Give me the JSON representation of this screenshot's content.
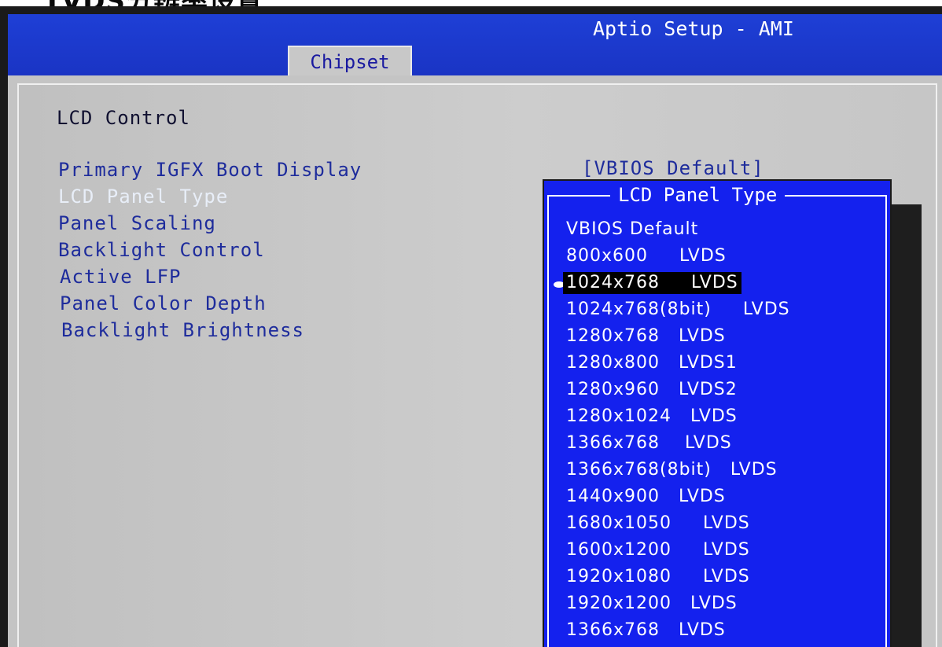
{
  "photo_heading": "LVDS分辨率设置",
  "header": {
    "title": "Aptio Setup - AMI",
    "tab": "Chipset"
  },
  "main": {
    "section_title": "LCD Control",
    "menu_items": [
      "Primary IGFX Boot Display",
      "LCD Panel Type",
      "Panel Scaling",
      "Backlight Control",
      "Active LFP",
      "Panel Color Depth",
      "Backlight Brightness"
    ],
    "current_value": "[VBIOS Default]"
  },
  "popup": {
    "title": "LCD Panel Type",
    "selected_index": 2,
    "options": [
      "VBIOS Default",
      "800x600     LVDS",
      "1024x768     LVDS",
      "1024x768(8bit)     LVDS",
      "1280x768   LVDS",
      "1280x800   LVDS1",
      "1280x960   LVDS2",
      "1280x1024   LVDS",
      "1366x768    LVDS",
      "1366x768(8bit)   LVDS",
      "1440x900   LVDS",
      "1680x1050     LVDS",
      "1600x1200     LVDS",
      "1920x1080     LVDS",
      "1920x1200   LVDS",
      "1366x768   LVDS"
    ]
  },
  "colors": {
    "header_blue": "#1e3fd6",
    "popup_blue": "#1421ee",
    "panel_gray": "#c4c4c4",
    "menu_text": "#1e2c9c"
  }
}
